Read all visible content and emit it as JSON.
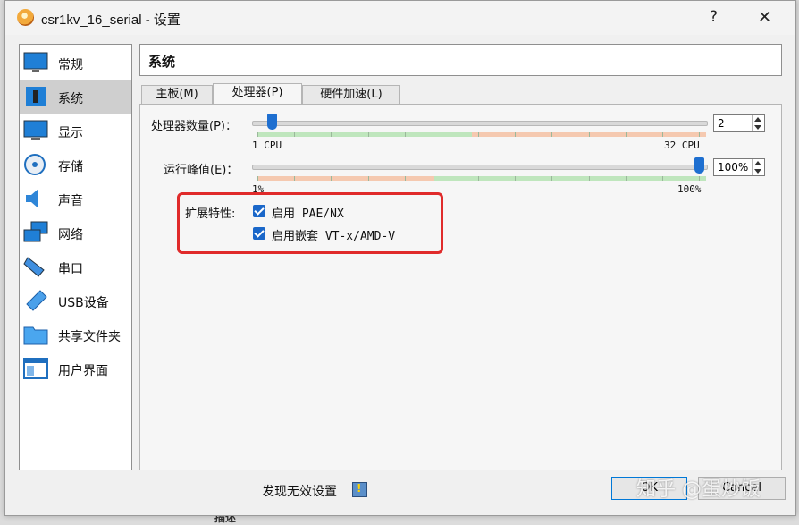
{
  "window": {
    "title": "csr1kv_16_serial - 设置",
    "help_label": "?",
    "close_label": "✕"
  },
  "sidebar": {
    "items": [
      {
        "label": "常规",
        "icon": "general-icon"
      },
      {
        "label": "系统",
        "icon": "system-icon",
        "selected": true
      },
      {
        "label": "显示",
        "icon": "display-icon"
      },
      {
        "label": "存储",
        "icon": "storage-icon"
      },
      {
        "label": "声音",
        "icon": "audio-icon"
      },
      {
        "label": "网络",
        "icon": "network-icon"
      },
      {
        "label": "串口",
        "icon": "serial-port-icon"
      },
      {
        "label": "USB设备",
        "icon": "usb-icon"
      },
      {
        "label": "共享文件夹",
        "icon": "shared-folder-icon"
      },
      {
        "label": "用户界面",
        "icon": "user-interface-icon"
      }
    ]
  },
  "header": {
    "title": "系统"
  },
  "tabs": [
    {
      "label": "主板(M)",
      "active": false
    },
    {
      "label": "处理器(P)",
      "active": true
    },
    {
      "label": "硬件加速(L)",
      "active": false
    }
  ],
  "processor": {
    "count_label": "处理器数量(P)：",
    "count_value": "2",
    "count_min_label": "1 CPU",
    "count_max_label": "32 CPU",
    "count_fraction": 0.032,
    "cap_label": "运行峰值(E)：",
    "cap_value": "100%",
    "cap_min_label": "1%",
    "cap_max_label": "100%",
    "cap_fraction": 1.0,
    "features_label": "扩展特性:",
    "pae_label": "启用 PAE/NX",
    "pae_checked": true,
    "vtx_label": "启用嵌套 VT-x/AMD-V",
    "vtx_checked": true
  },
  "footer": {
    "invalid_settings": "发现无效设置",
    "ok_label": "OK",
    "cancel_label": "Cancel"
  },
  "watermark": "知乎 @蛋炒饭",
  "background_text": "描述",
  "colors": {
    "slider_handle": "#1e6fd0",
    "zone_green": "#bfe6bd",
    "zone_orange": "#f5c9b0",
    "highlight_border": "#e02b2b",
    "checkbox": "#1a67c9",
    "selected_item": "#cfcfcf"
  }
}
